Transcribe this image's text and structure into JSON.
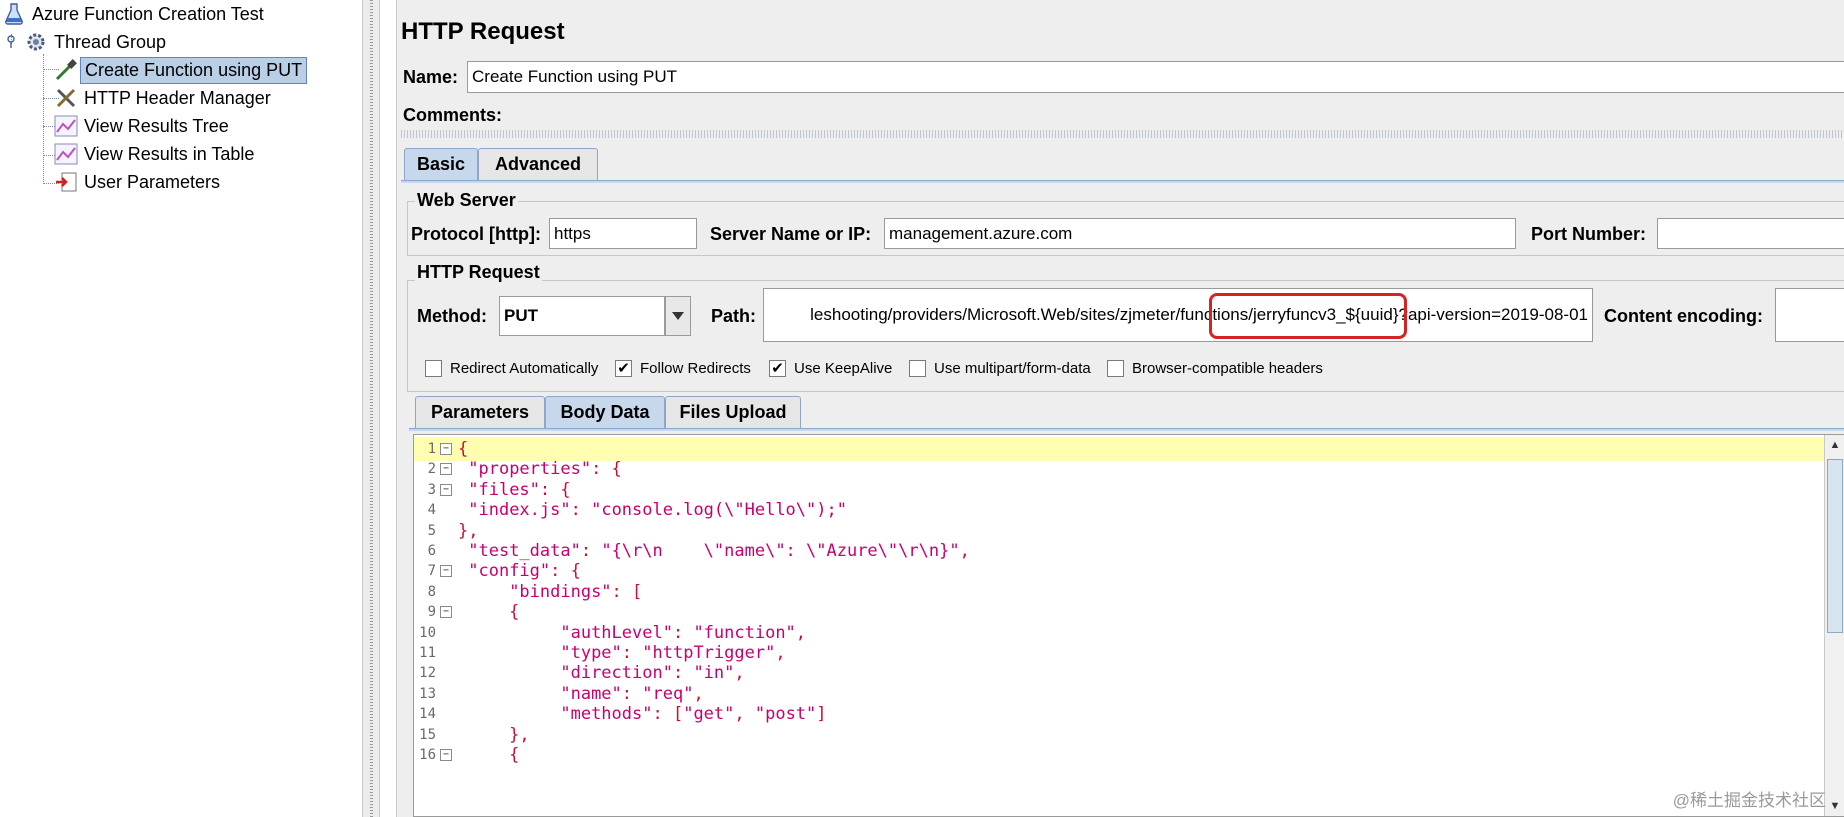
{
  "tree": {
    "root": "Azure Function Creation Test",
    "thread_group": "Thread Group",
    "items": [
      {
        "label": "Create Function using PUT",
        "icon": "pipette-icon"
      },
      {
        "label": "HTTP Header Manager",
        "icon": "wrench-icon"
      },
      {
        "label": "View Results Tree",
        "icon": "graph-icon"
      },
      {
        "label": "View Results in Table",
        "icon": "graph-icon"
      },
      {
        "label": "User Parameters",
        "icon": "preprocessor-icon"
      }
    ]
  },
  "panel": {
    "title": "HTTP Request",
    "name_label": "Name:",
    "name_value": "Create Function using PUT",
    "comments_label": "Comments:",
    "tabs": [
      "Basic",
      "Advanced"
    ],
    "web_server": {
      "title": "Web Server",
      "protocol_label": "Protocol [http]:",
      "protocol_value": "https",
      "server_label": "Server Name or IP:",
      "server_value": "management.azure.com",
      "port_label": "Port Number:",
      "port_value": ""
    },
    "http_request": {
      "title": "HTTP Request",
      "method_label": "Method:",
      "method_value": "PUT",
      "path_label": "Path:",
      "path_value": "leshooting/providers/Microsoft.Web/sites/zjmeter/functions/jerryfuncv3_${uuid}?api-version=2019-08-01",
      "encoding_label": "Content encoding:",
      "encoding_value": ""
    },
    "checkboxes": [
      {
        "label": "Redirect Automatically",
        "checked": false
      },
      {
        "label": "Follow Redirects",
        "checked": true
      },
      {
        "label": "Use KeepAlive",
        "checked": true
      },
      {
        "label": "Use multipart/form-data",
        "checked": false
      },
      {
        "label": "Browser-compatible headers",
        "checked": false
      }
    ],
    "subtabs": [
      "Parameters",
      "Body Data",
      "Files Upload"
    ],
    "body_lines": [
      "{",
      " \"properties\": {",
      " \"files\": {",
      " \"index.js\": \"console.log(\\\"Hello\\\");\"",
      "},",
      " \"test_data\": \"{\\r\\n    \\\"name\\\": \\\"Azure\\\"\\r\\n}\",",
      " \"config\": {",
      "     \"bindings\": [",
      "     {",
      "          \"authLevel\": \"function\",",
      "          \"type\": \"httpTrigger\",",
      "          \"direction\": \"in\",",
      "          \"name\": \"req\",",
      "          \"methods\": [\"get\", \"post\"]",
      "     },",
      "     {"
    ],
    "line_numbers": [
      "1",
      "2",
      "3",
      "4",
      "5",
      "6",
      "7",
      "8",
      "9",
      "10",
      "11",
      "12",
      "13",
      "14",
      "15",
      "16"
    ],
    "fold_lines": [
      1,
      2,
      3,
      7,
      9,
      16
    ]
  },
  "watermark": "@稀土掘金技术社区"
}
